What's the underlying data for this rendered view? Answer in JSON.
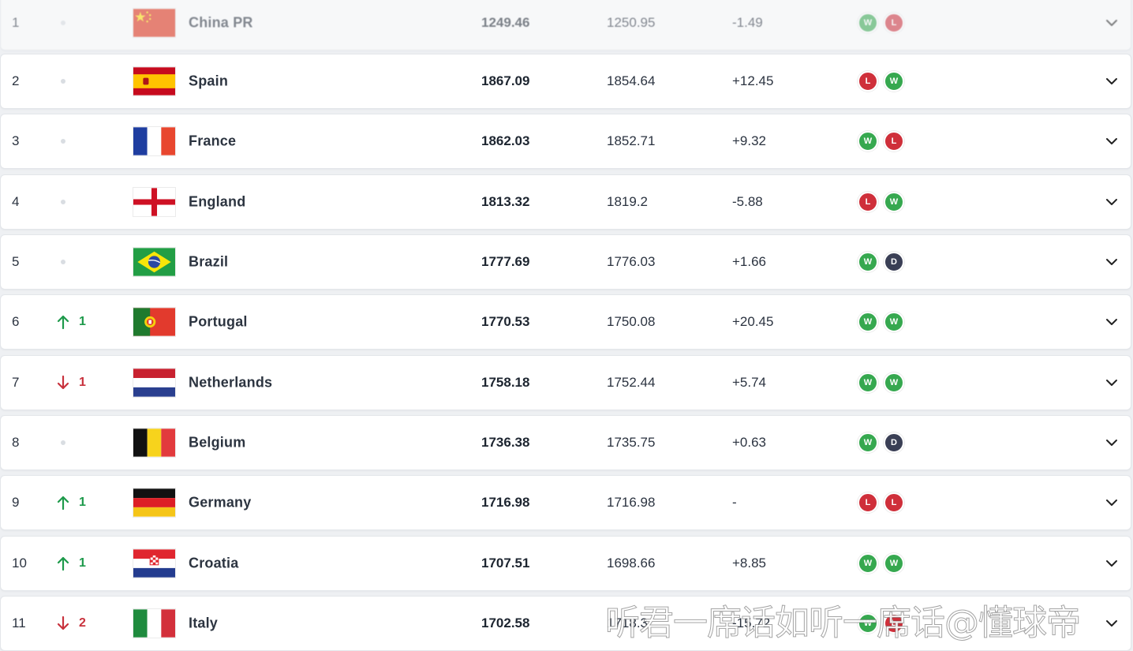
{
  "colors": {
    "win": "#36a84f",
    "loss": "#cf2f3a",
    "draw": "#3a3f55",
    "movement_up": "#1e9a4b",
    "movement_down": "#c8323d"
  },
  "icons": {
    "expand": "chevron-down-icon",
    "up": "arrow-up-icon",
    "down": "arrow-down-icon",
    "unchanged": "dot-icon"
  },
  "rankings": [
    {
      "rank": "1",
      "movement": {
        "direction": "none",
        "value": ""
      },
      "flag": "china",
      "team": "China PR",
      "total_points": "1249.46",
      "previous_points": "1250.95",
      "difference": "-1.49",
      "results": [
        "W",
        "L"
      ]
    },
    {
      "rank": "2",
      "movement": {
        "direction": "none",
        "value": ""
      },
      "flag": "spain",
      "team": "Spain",
      "total_points": "1867.09",
      "previous_points": "1854.64",
      "difference": "+12.45",
      "results": [
        "L",
        "W"
      ]
    },
    {
      "rank": "3",
      "movement": {
        "direction": "none",
        "value": ""
      },
      "flag": "france",
      "team": "France",
      "total_points": "1862.03",
      "previous_points": "1852.71",
      "difference": "+9.32",
      "results": [
        "W",
        "L"
      ]
    },
    {
      "rank": "4",
      "movement": {
        "direction": "none",
        "value": ""
      },
      "flag": "england",
      "team": "England",
      "total_points": "1813.32",
      "previous_points": "1819.2",
      "difference": "-5.88",
      "results": [
        "L",
        "W"
      ]
    },
    {
      "rank": "5",
      "movement": {
        "direction": "none",
        "value": ""
      },
      "flag": "brazil",
      "team": "Brazil",
      "total_points": "1777.69",
      "previous_points": "1776.03",
      "difference": "+1.66",
      "results": [
        "W",
        "D"
      ]
    },
    {
      "rank": "6",
      "movement": {
        "direction": "up",
        "value": "1"
      },
      "flag": "portugal",
      "team": "Portugal",
      "total_points": "1770.53",
      "previous_points": "1750.08",
      "difference": "+20.45",
      "results": [
        "W",
        "W"
      ]
    },
    {
      "rank": "7",
      "movement": {
        "direction": "down",
        "value": "1"
      },
      "flag": "netherlands",
      "team": "Netherlands",
      "total_points": "1758.18",
      "previous_points": "1752.44",
      "difference": "+5.74",
      "results": [
        "W",
        "W"
      ]
    },
    {
      "rank": "8",
      "movement": {
        "direction": "none",
        "value": ""
      },
      "flag": "belgium",
      "team": "Belgium",
      "total_points": "1736.38",
      "previous_points": "1735.75",
      "difference": "+0.63",
      "results": [
        "W",
        "D"
      ]
    },
    {
      "rank": "9",
      "movement": {
        "direction": "up",
        "value": "1"
      },
      "flag": "germany",
      "team": "Germany",
      "total_points": "1716.98",
      "previous_points": "1716.98",
      "difference": "-",
      "results": [
        "L",
        "L"
      ]
    },
    {
      "rank": "10",
      "movement": {
        "direction": "up",
        "value": "1"
      },
      "flag": "croatia",
      "team": "Croatia",
      "total_points": "1707.51",
      "previous_points": "1698.66",
      "difference": "+8.85",
      "results": [
        "W",
        "W"
      ]
    },
    {
      "rank": "11",
      "movement": {
        "direction": "down",
        "value": "2"
      },
      "flag": "italy",
      "team": "Italy",
      "total_points": "1702.58",
      "previous_points": "1718.3",
      "difference": "-15.72",
      "results": [
        "W",
        "L"
      ]
    }
  ],
  "watermark": "听君一席话如听一席话@懂球帝"
}
